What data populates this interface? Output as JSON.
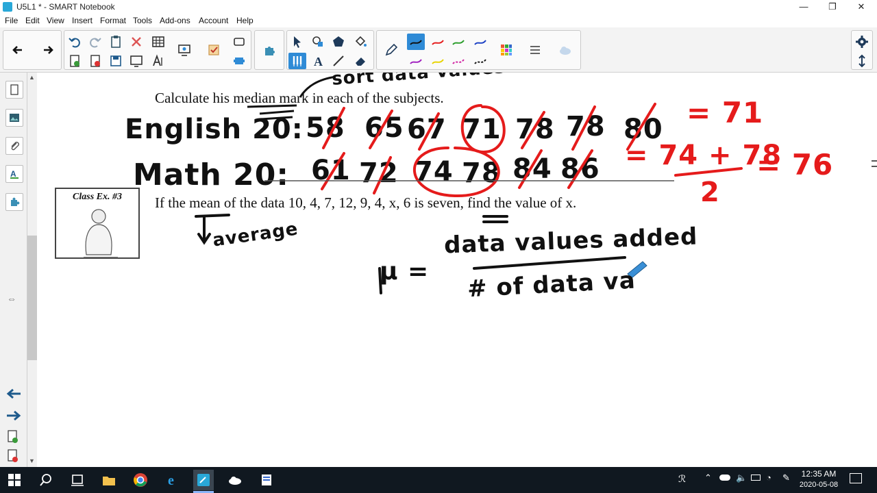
{
  "window": {
    "title": "U5L1 * - SMART Notebook",
    "minimize": "—",
    "restore": "❐",
    "close": "✕"
  },
  "menu": [
    "File",
    "Edit",
    "View",
    "Insert",
    "Format",
    "Tools",
    "Add-ons",
    "Account",
    "Help"
  ],
  "colors": {
    "ink_black": "#111111",
    "ink_red": "#e51b1b",
    "accent_blue": "#2f8bd6",
    "taskbar": "#101820"
  },
  "canvas": {
    "question1": "Calculate his median mark in each of the subjects.",
    "question2": "If the mean of the data 10, 4, 7, 12, 9, 4, x,  6 is seven, find the value of x.",
    "class_ex_label": "Class Ex. #3",
    "ink_top_note": "sort data values",
    "english_label": "English 20:",
    "english_values": [
      "58",
      "65",
      "67",
      "71",
      "78",
      "78",
      "80"
    ],
    "english_result": "= 71",
    "math_label": "Math 20:",
    "math_values": [
      "61",
      "72",
      "74",
      "78",
      "84",
      "86"
    ],
    "math_result_num": "= 74 + 78",
    "math_result_den": "2",
    "math_result_final": "= 76",
    "average_note": "average",
    "mu_symbol": "μ =",
    "formula_num": "data values added",
    "formula_den": "# of data va"
  },
  "taskbar": {
    "time": "12:35 AM",
    "date": "2020-05-08"
  }
}
